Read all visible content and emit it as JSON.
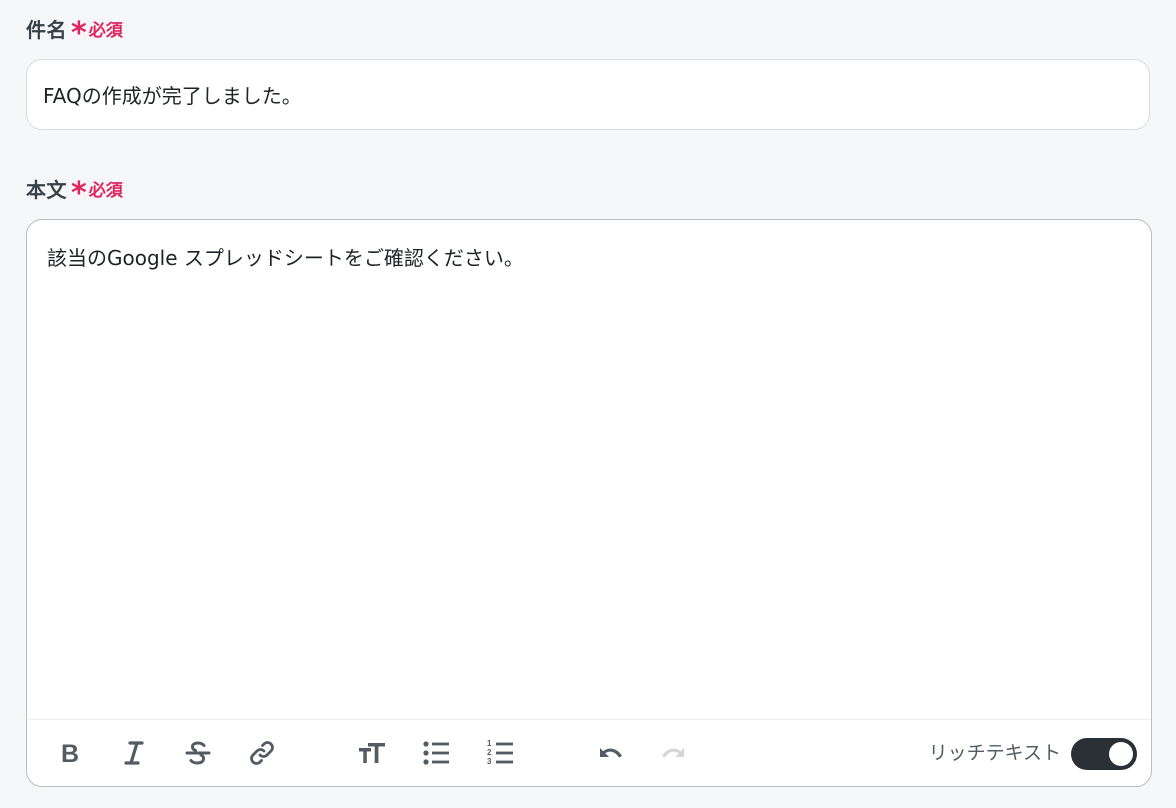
{
  "subject": {
    "label": "件名",
    "required_star": "*",
    "required_text": "必須",
    "value": "FAQの作成が完了しました。"
  },
  "body": {
    "label": "本文",
    "required_star": "*",
    "required_text": "必須",
    "value": "該当のGoogle スプレッドシートをご確認ください。"
  },
  "toolbar": {
    "buttons": [
      "bold-icon",
      "italic-icon",
      "strikethrough-icon",
      "link-icon",
      "text-size-icon",
      "bullet-list-icon",
      "numbered-list-icon",
      "undo-icon",
      "redo-icon"
    ],
    "rich_text_label": "リッチテキスト",
    "rich_text_enabled": true
  },
  "colors": {
    "required": "#e0245e",
    "toggle_on": "#2b2f36",
    "icon": "#555b63",
    "icon_disabled": "#d4d6da"
  }
}
